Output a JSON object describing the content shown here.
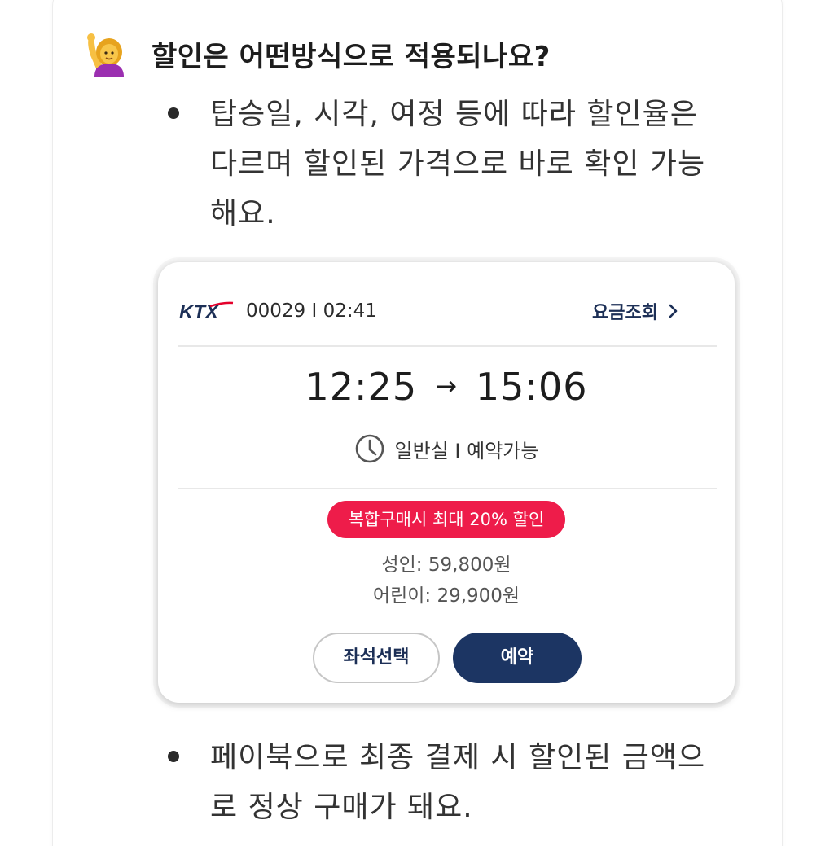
{
  "faq": {
    "question": "할인은 어떤방식으로 적용되나요?",
    "question_icon": "person-raising-hand-emoji",
    "bullets": [
      "탑승일, 시각, 여정 등에 따라 할인율은 다르며 할인된 가격으로 바로 확인 가능해요.",
      "페이북으로 최종 결제 시 할인된 금액으로 정상 구매가 돼요."
    ]
  },
  "ticket": {
    "logo_text": "KTX",
    "train_info": "00029 I 02:41",
    "fare_link": "요금조회",
    "departure": "12:25",
    "arrow": "→",
    "arrival": "15:06",
    "class_info": "일반실 I 예약가능",
    "discount_badge": "복합구매시 최대 20% 할인",
    "adult_price": "성인: 59,800원",
    "child_price": "어린이: 29,900원",
    "seat_button": "좌석선택",
    "book_button": "예약"
  },
  "colors": {
    "badge": "#ee1c4a",
    "brand_navy": "#1c3563",
    "ktx_red": "#e4002b"
  }
}
